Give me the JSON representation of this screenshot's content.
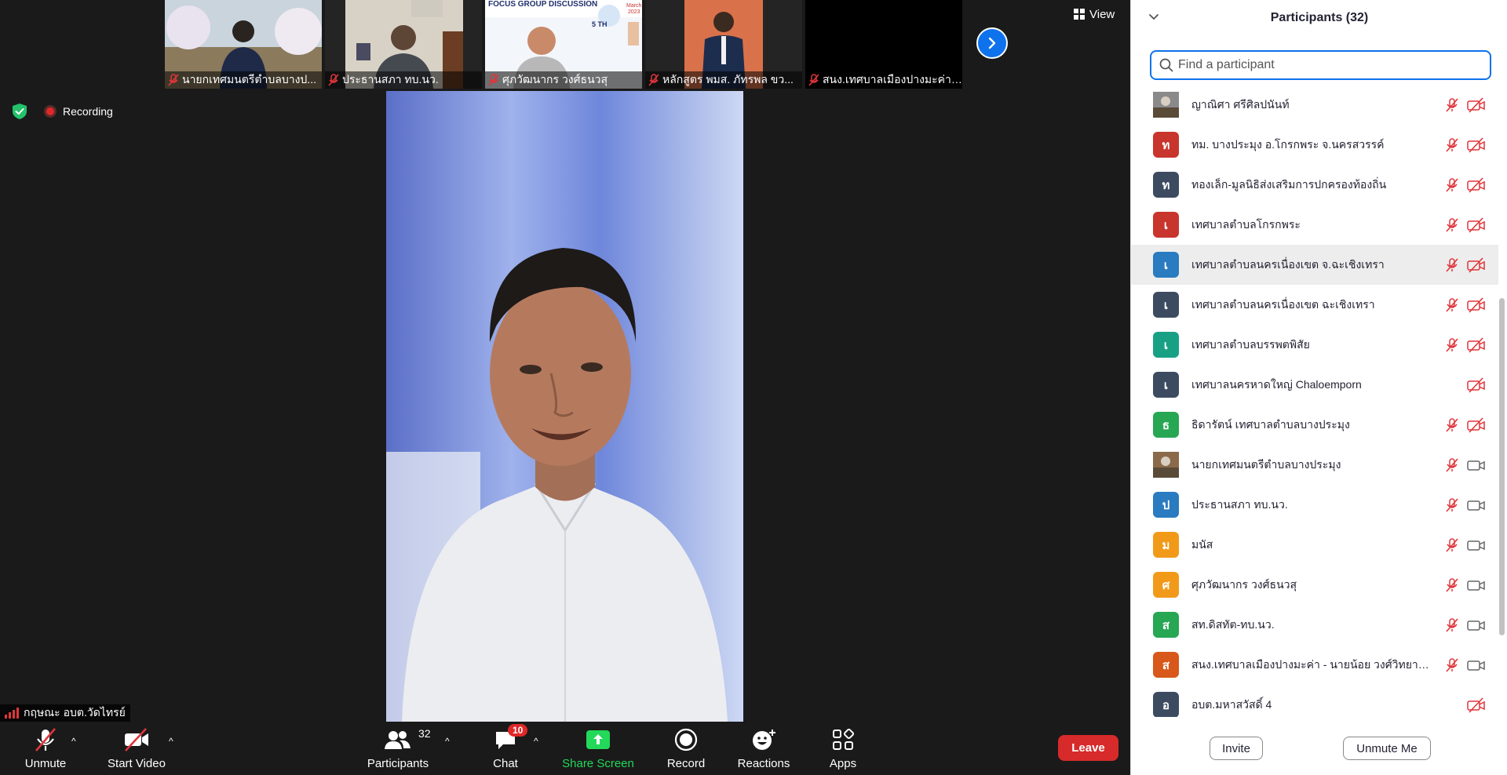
{
  "thumbnails": [
    {
      "name": "นายกเทศมนตรีตำบลบางป..."
    },
    {
      "name": "ประธานสภา ทบ.นว."
    },
    {
      "name": "ศุภวัฒนากร วงศ์ธนวสุ"
    },
    {
      "name": "หลักสูตร พมส. ภัทรพล ขว..."
    },
    {
      "name": "สนง.เทศบาลเมืองปางมะค่า ..."
    }
  ],
  "thumbnail_banner": {
    "line1": "FOCUS GROUP DISCUSSION",
    "line2": "5 TH",
    "month": "March",
    "year": "2023"
  },
  "view_button": {
    "label": "View"
  },
  "recording": {
    "label": "Recording"
  },
  "speaker": {
    "name": "กฤษณะ  อบต.วัดไทรย์"
  },
  "toolbar": {
    "unmute": "Unmute",
    "start_video": "Start Video",
    "participants": "Participants",
    "participants_count": "32",
    "chat": "Chat",
    "chat_badge": "10",
    "share_screen": "Share Screen",
    "record": "Record",
    "reactions": "Reactions",
    "apps": "Apps",
    "leave": "Leave"
  },
  "colors": {
    "accent": "#0e72ed",
    "leave": "#d72a2a",
    "share": "#23d959",
    "muted": "#e0353b"
  },
  "panel": {
    "title": "Participants (32)",
    "search_placeholder": "Find a participant",
    "invite": "Invite",
    "unmute_me": "Unmute Me"
  },
  "participants": [
    {
      "name": "ญาณิศา ศรีศิลปนันท์",
      "initial": "",
      "color": "#8a8a8a",
      "photo": true,
      "cam": "off",
      "mic": true
    },
    {
      "name": "ทม. บางประมุง อ.โกรกพระ จ.นครสวรรค์",
      "initial": "ท",
      "color": "#c8352d",
      "cam": "off",
      "mic": true
    },
    {
      "name": "ทองเล็ก-มูลนิธิส่งเสริมการปกครองท้องถิ่น",
      "initial": "ท",
      "color": "#3d4b61",
      "cam": "off",
      "mic": true
    },
    {
      "name": "เทศบาลตำบลโกรกพระ",
      "initial": "เ",
      "color": "#c8352d",
      "cam": "off",
      "mic": true
    },
    {
      "name": "เทศบาลตำบลนครเนื่องเขต จ.ฉะเชิงเทรา",
      "initial": "เ",
      "color": "#2a7bc0",
      "cam": "off",
      "mic": true,
      "highlight": true
    },
    {
      "name": "เทศบาลตำบลนครเนื่องเขต ฉะเชิงเทรา",
      "initial": "เ",
      "color": "#3d4b61",
      "cam": "off",
      "mic": true
    },
    {
      "name": "เทศบาลตำบลบรรพตพิสัย",
      "initial": "เ",
      "color": "#18a085",
      "cam": "off",
      "mic": true
    },
    {
      "name": "เทศบาลนครหาดใหญ่ Chaloemporn",
      "initial": "เ",
      "color": "#3d4b61",
      "cam": "off",
      "mic": false
    },
    {
      "name": "ธิดารัตน์  เทศบาลตำบลบางประมุง",
      "initial": "ธ",
      "color": "#27a653",
      "cam": "off",
      "mic": true
    },
    {
      "name": "นายกเทศมนตรีตำบลบางประมุง",
      "initial": "",
      "color": "#8a6a4a",
      "photo": true,
      "cam": "on",
      "mic": true
    },
    {
      "name": "ประธานสภา ทบ.นว.",
      "initial": "ป",
      "color": "#2a7bc0",
      "cam": "on",
      "mic": true
    },
    {
      "name": "มนัส",
      "initial": "ม",
      "color": "#f19a1a",
      "cam": "on",
      "mic": true
    },
    {
      "name": "ศุภวัฒนากร วงศ์ธนวสุ",
      "initial": "ศ",
      "color": "#f19a1a",
      "cam": "on",
      "mic": true
    },
    {
      "name": "สท.ดิสทัต-ทบ.นว.",
      "initial": "ส",
      "color": "#27a653",
      "cam": "on",
      "mic": true
    },
    {
      "name": "สนง.เทศบาลเมืองปางมะค่า - นายน้อย วงศ์วิทยานันท์.",
      "initial": "ส",
      "color": "#d7581a",
      "cam": "on",
      "mic": true
    },
    {
      "name": "อบต.มหาสวัสดิ์ 4",
      "initial": "อ",
      "color": "#3d4b61",
      "cam": "off",
      "mic": false
    }
  ]
}
